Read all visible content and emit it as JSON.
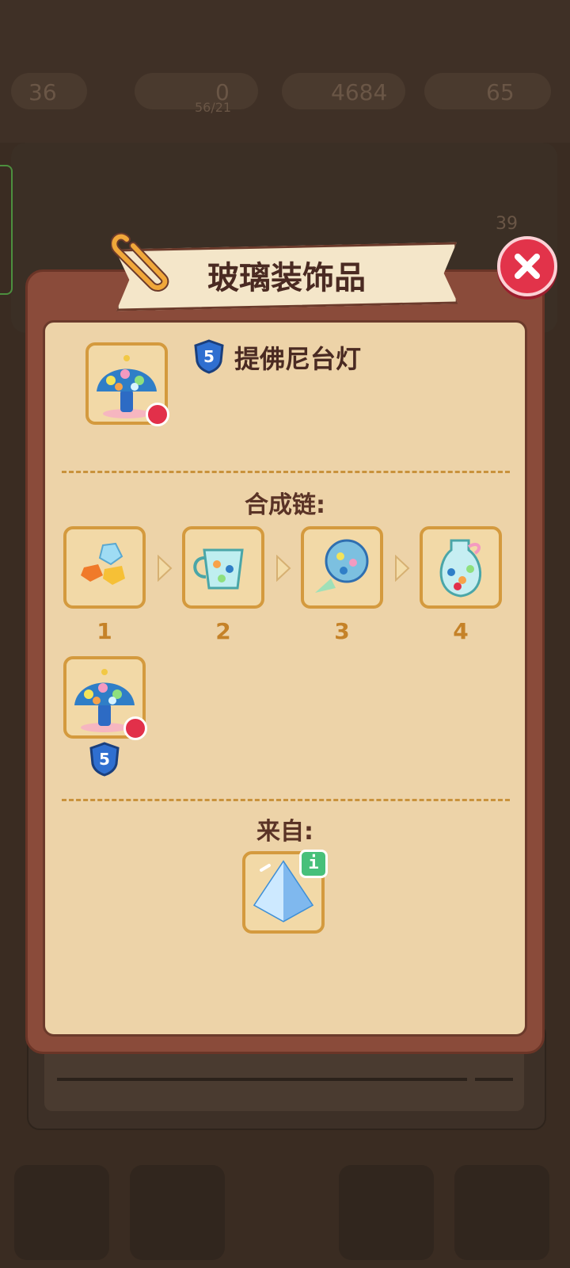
{
  "background": {
    "stat_values": [
      "36",
      "0",
      "4684",
      "65"
    ],
    "stat_sub": "56/21",
    "badge_value": "39"
  },
  "modal": {
    "title": "玻璃装饰品",
    "close_icon": "close-x-icon",
    "item": {
      "name": "提佛尼台灯",
      "level": "5",
      "icon": "tiffany-lamp-icon"
    },
    "merge_chain": {
      "title": "合成链:",
      "steps": [
        {
          "num": "1",
          "icon": "glass-gems-icon"
        },
        {
          "num": "2",
          "icon": "mosaic-cup-icon"
        },
        {
          "num": "3",
          "icon": "mosaic-wind-chime-icon"
        },
        {
          "num": "4",
          "icon": "mosaic-vase-icon"
        },
        {
          "num": "",
          "icon": "tiffany-lamp-icon",
          "level": "5"
        }
      ]
    },
    "source": {
      "title": "来自:",
      "icon": "glass-pyramid-icon",
      "info_label": "i"
    }
  },
  "colors": {
    "frame": "#8a4b3a",
    "panel": "#edd3a8",
    "accent": "#d49a3e",
    "close": "#e2334a",
    "level_badge": "#2f6fd0"
  }
}
